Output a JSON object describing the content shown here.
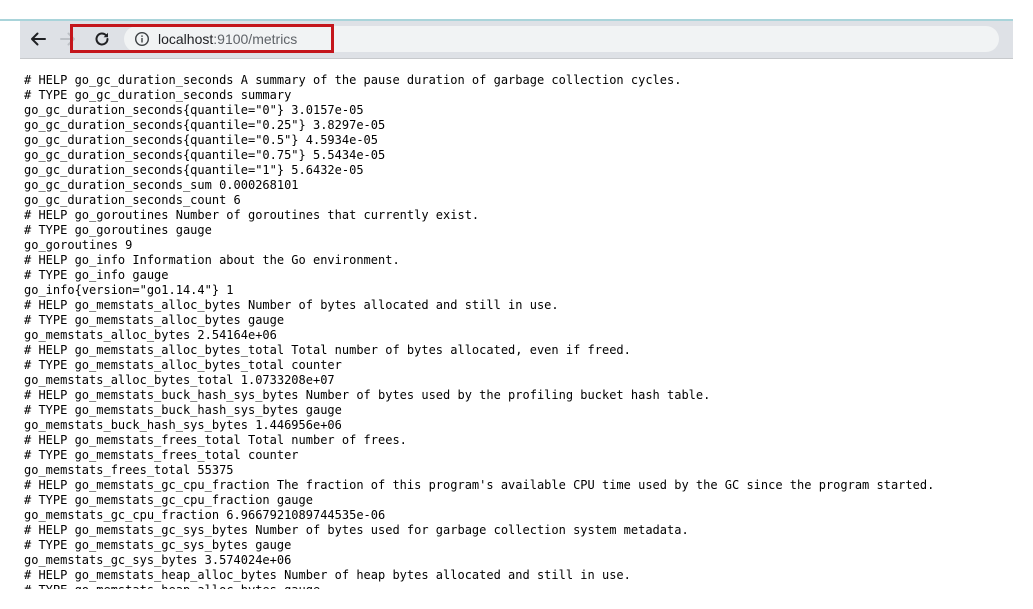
{
  "browser": {
    "url_host": "localhost",
    "url_rest": ":9100/metrics",
    "back_icon": "back-arrow-icon",
    "forward_icon": "forward-arrow-icon",
    "reload_icon": "reload-icon",
    "info_icon": "info-icon",
    "highlight_color": "#c4161c"
  },
  "page": {
    "lines": [
      "# HELP go_gc_duration_seconds A summary of the pause duration of garbage collection cycles.",
      "# TYPE go_gc_duration_seconds summary",
      "go_gc_duration_seconds{quantile=\"0\"} 3.0157e-05",
      "go_gc_duration_seconds{quantile=\"0.25\"} 3.8297e-05",
      "go_gc_duration_seconds{quantile=\"0.5\"} 4.5934e-05",
      "go_gc_duration_seconds{quantile=\"0.75\"} 5.5434e-05",
      "go_gc_duration_seconds{quantile=\"1\"} 5.6432e-05",
      "go_gc_duration_seconds_sum 0.000268101",
      "go_gc_duration_seconds_count 6",
      "# HELP go_goroutines Number of goroutines that currently exist.",
      "# TYPE go_goroutines gauge",
      "go_goroutines 9",
      "# HELP go_info Information about the Go environment.",
      "# TYPE go_info gauge",
      "go_info{version=\"go1.14.4\"} 1",
      "# HELP go_memstats_alloc_bytes Number of bytes allocated and still in use.",
      "# TYPE go_memstats_alloc_bytes gauge",
      "go_memstats_alloc_bytes 2.54164e+06",
      "# HELP go_memstats_alloc_bytes_total Total number of bytes allocated, even if freed.",
      "# TYPE go_memstats_alloc_bytes_total counter",
      "go_memstats_alloc_bytes_total 1.0733208e+07",
      "# HELP go_memstats_buck_hash_sys_bytes Number of bytes used by the profiling bucket hash table.",
      "# TYPE go_memstats_buck_hash_sys_bytes gauge",
      "go_memstats_buck_hash_sys_bytes 1.446956e+06",
      "# HELP go_memstats_frees_total Total number of frees.",
      "# TYPE go_memstats_frees_total counter",
      "go_memstats_frees_total 55375",
      "# HELP go_memstats_gc_cpu_fraction The fraction of this program's available CPU time used by the GC since the program started.",
      "# TYPE go_memstats_gc_cpu_fraction gauge",
      "go_memstats_gc_cpu_fraction 6.9667921089744535e-06",
      "# HELP go_memstats_gc_sys_bytes Number of bytes used for garbage collection system metadata.",
      "# TYPE go_memstats_gc_sys_bytes gauge",
      "go_memstats_gc_sys_bytes 3.574024e+06",
      "# HELP go_memstats_heap_alloc_bytes Number of heap bytes allocated and still in use.",
      "# TYPE go_memstats_heap_alloc_bytes gauge"
    ]
  }
}
